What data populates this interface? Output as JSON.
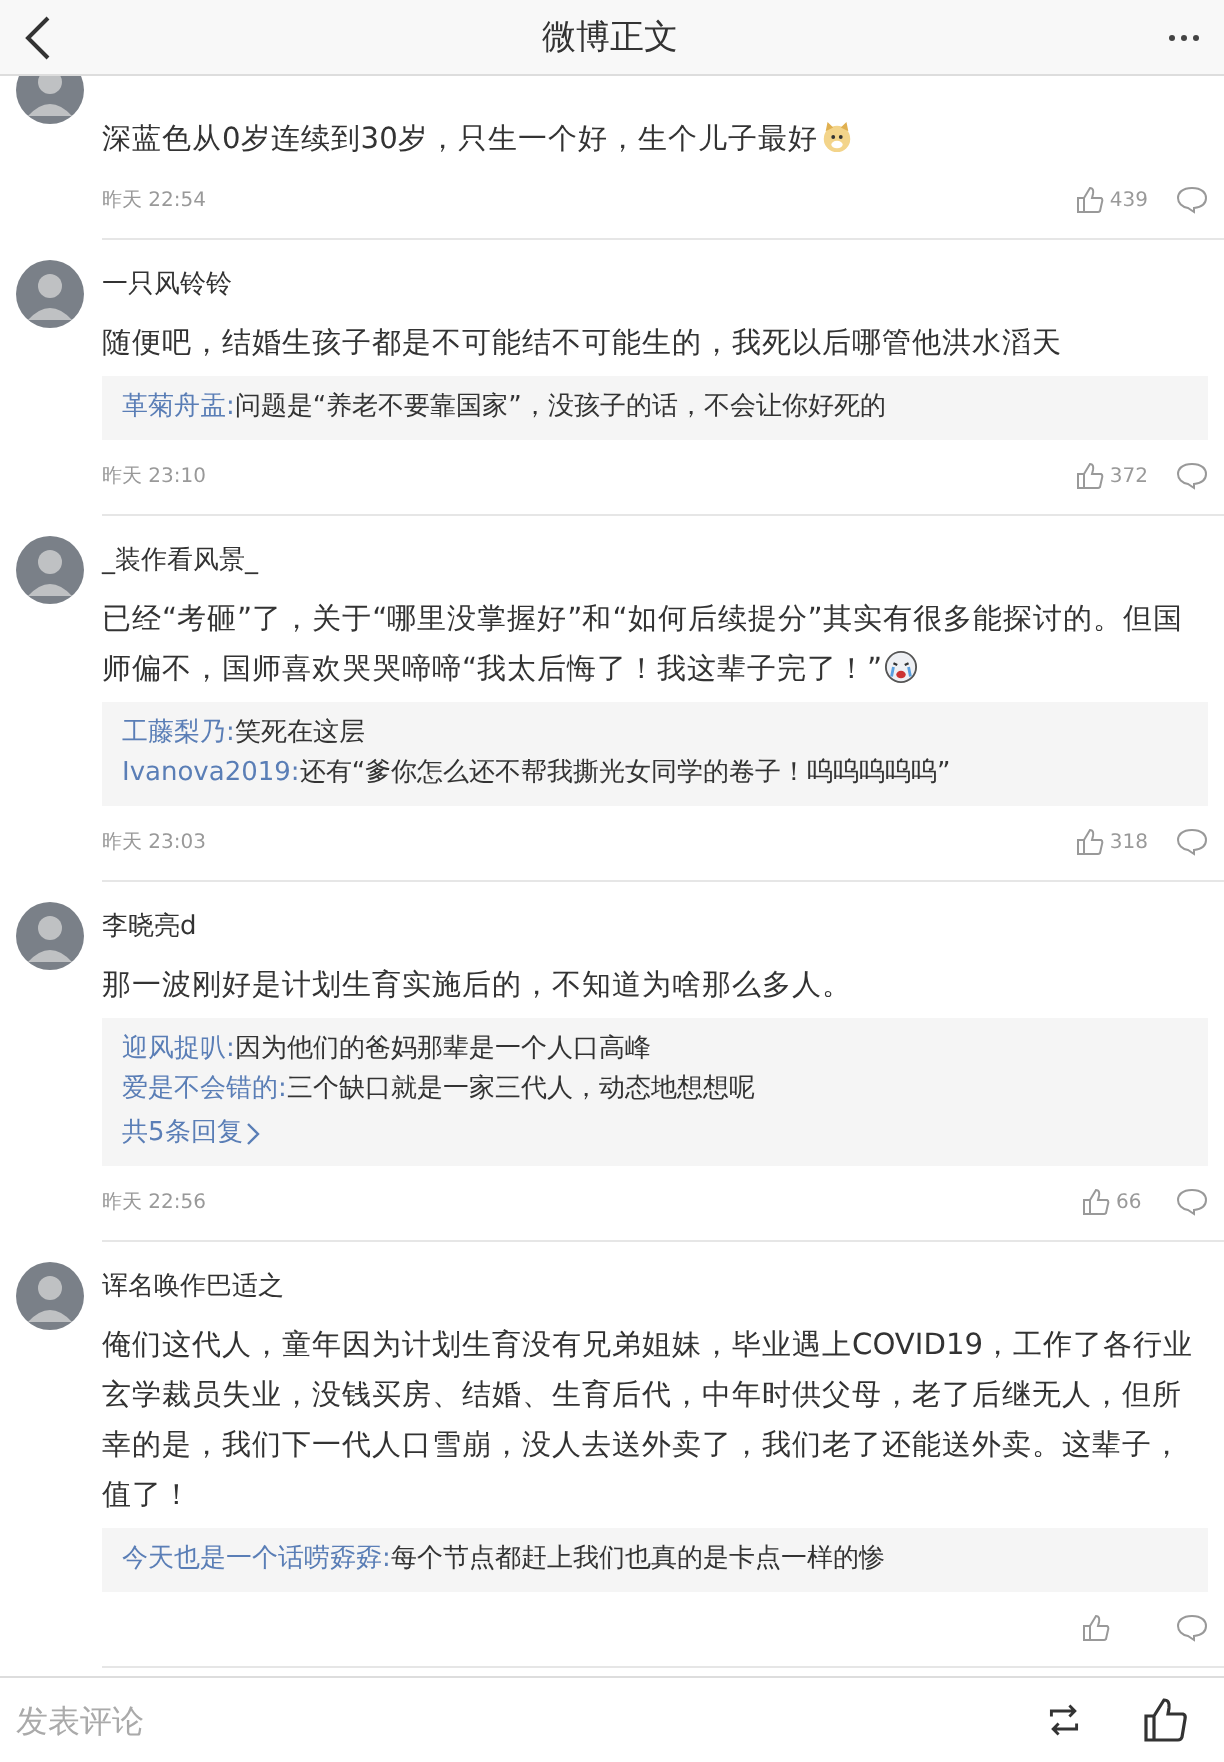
{
  "header": {
    "title": "微博正文"
  },
  "comments": [
    {
      "text": "深蓝色从0岁连续到30岁，只生一个好，生个儿子最好",
      "emoji": {
        "kind": "dog"
      },
      "time": "昨天 22:54",
      "likes": "439"
    },
    {
      "name": "一只风铃铃",
      "text": "随便吧，结婚生孩子都是不可能结不可能生的，我死以后哪管他洪水滔天",
      "replies": [
        {
          "user": "革菊舟盂:",
          "text": "问题是“养老不要靠国家”，没孩子的话，不会让你好死的"
        }
      ],
      "time": "昨天 23:10",
      "likes": "372"
    },
    {
      "name": "_装作看风景_",
      "text": "已经“考砸”了，关于“哪里没掌握好”和“如何后续提分”其实有很多能探讨的。但国师偏不，国师喜欢哭哭啼啼“我太后悔了！我这辈子完了！”",
      "emoji": {
        "kind": "cry"
      },
      "replies": [
        {
          "user": "工藤梨乃:",
          "text": "笑死在这层"
        },
        {
          "user": "Ivanova2019:",
          "text": "还有“爹你怎么还不帮我撕光女同学的卷子！呜呜呜呜呜”"
        }
      ],
      "time": "昨天 23:03",
      "likes": "318"
    },
    {
      "name": "李晓亮d",
      "text": "那一波刚好是计划生育实施后的，不知道为啥那么多人。",
      "replies": [
        {
          "user": "迎风捉叭:",
          "text": "因为他们的爸妈那辈是一个人口高峰"
        },
        {
          "user": "爱是不会错的:",
          "text": "三个缺口就是一家三代人，动态地想想呢"
        }
      ],
      "more": "共5条回复",
      "time": "昨天 22:56",
      "likes": "66"
    },
    {
      "name": "诨名唤作巴适之",
      "text": "俺们这代人，童年因为计划生育没有兄弟姐妹，毕业遇上COVID19，工作了各行业玄学裁员失业，没钱买房、结婚、生育后代，中年时供父母，老了后继无人，但所幸的是，我们下一代人口雪崩，没人去送外卖了，我们老了还能送外卖。这辈子，值了！",
      "replies": [
        {
          "user": "今天也是一个话唠孬孬:",
          "text": "每个节点都赶上我们也真的是卡点一样的惨"
        }
      ]
    }
  ],
  "footer": {
    "placeholder": "发表评论"
  }
}
